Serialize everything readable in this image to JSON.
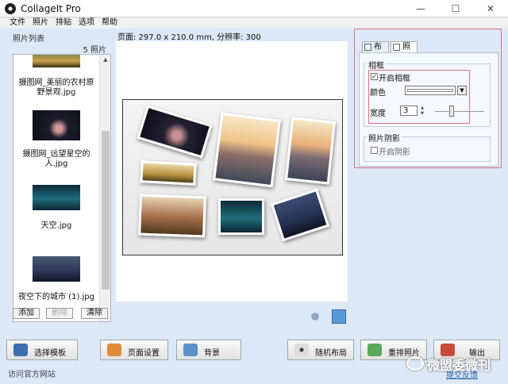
{
  "window": {
    "title": "CollageIt Pro"
  },
  "menu": [
    "文件",
    "照片",
    "排贴",
    "选项",
    "帮助"
  ],
  "photo_list": {
    "title": "照片列表",
    "count": "5 照片",
    "items": [
      {
        "caption": "摄图网_美丽的农村原野景观.jpg"
      },
      {
        "caption": "摄图网_远望星空的人.jpg"
      },
      {
        "caption": "天空.jpg"
      },
      {
        "caption": "夜空下的城市 (1).jpg"
      }
    ],
    "buttons": {
      "add": "添加",
      "remove": "删除",
      "clear": "清除"
    }
  },
  "page_info": "页面: 297.0 x 210.0 mm, 分辨率: 300",
  "right_panel": {
    "tabs": [
      {
        "label": "布局"
      },
      {
        "label": "照片"
      }
    ],
    "border_group": {
      "title": "相框",
      "enable_label": "开启相框",
      "enabled": true,
      "color_label": "颜色",
      "width_label": "宽度",
      "width_value": "3"
    },
    "shadow_group": {
      "title": "照片阴影",
      "enable_label": "开启阴影",
      "enabled": false
    }
  },
  "bottom_buttons": {
    "choose_template": "选择模板",
    "page_setup": "页面设置",
    "background": "背景",
    "random_layout": "随机布局",
    "reorder_photos": "重排照片",
    "output": "输出"
  },
  "footer": {
    "left": "访问官方网站",
    "right": "提交反馈"
  },
  "watermark": "微盟委微刊"
}
